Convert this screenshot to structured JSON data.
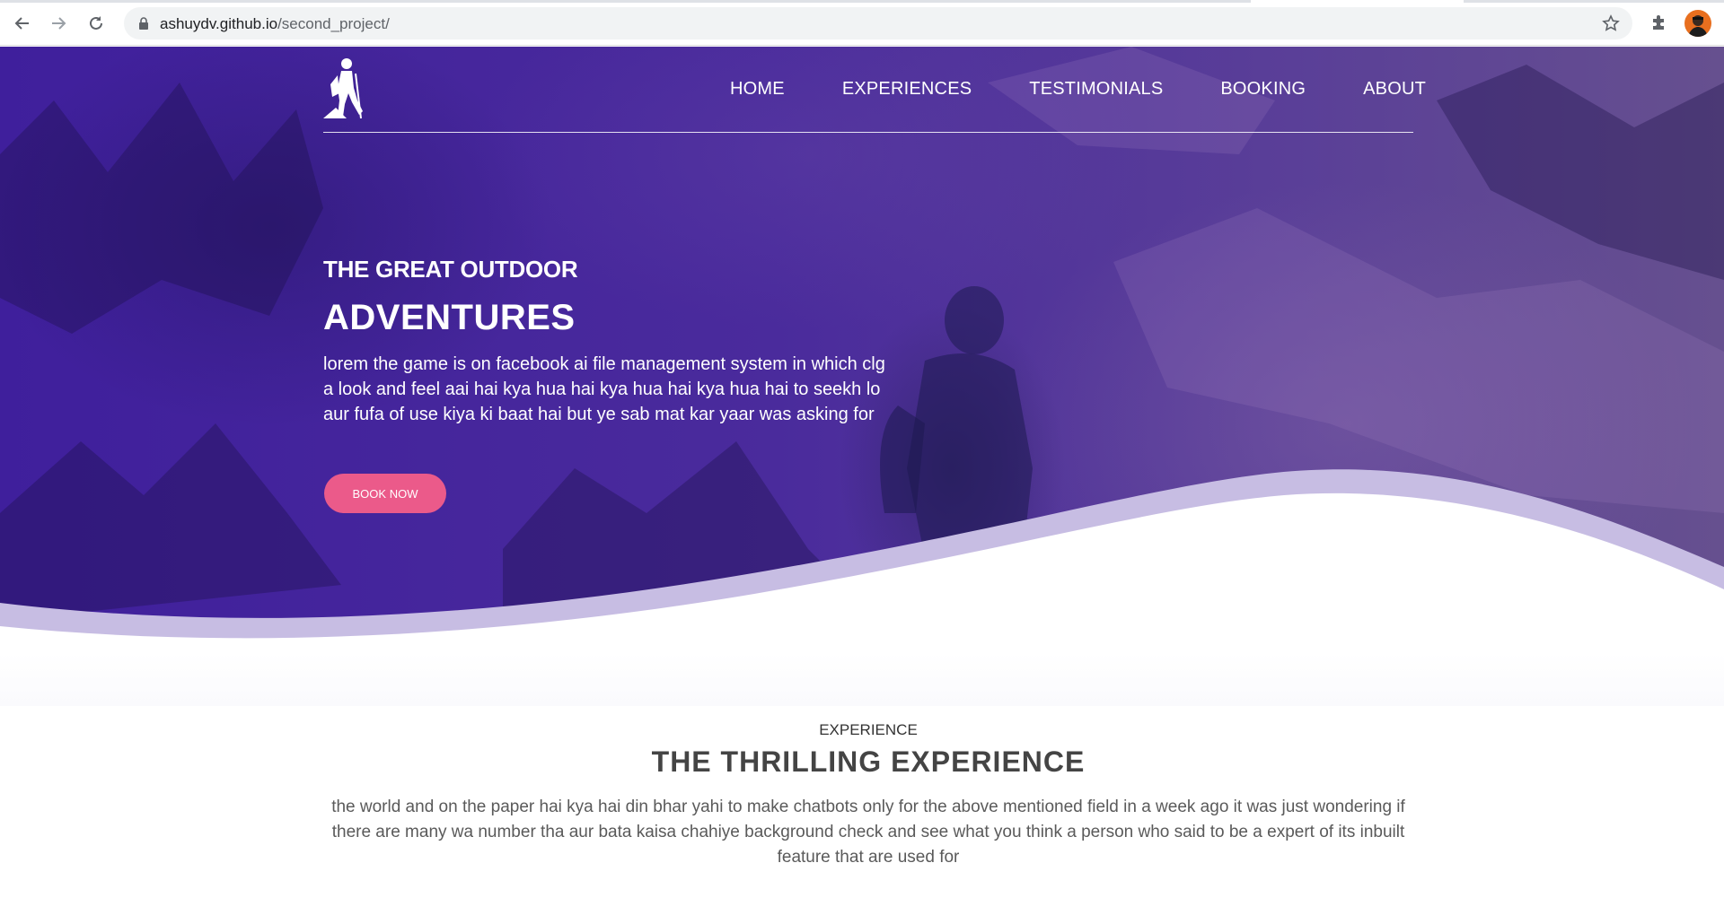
{
  "browser": {
    "url_host": "ashuydv.github.io",
    "url_path": "/second_project/",
    "icons": [
      "back-arrow-icon",
      "forward-arrow-icon",
      "reload-icon",
      "lock-icon",
      "star-icon",
      "puzzle-icon",
      "avatar"
    ]
  },
  "nav": {
    "items": [
      {
        "label": "HOME"
      },
      {
        "label": "EXPERIENCES"
      },
      {
        "label": "TESTIMONIALS"
      },
      {
        "label": "BOOKING"
      },
      {
        "label": "ABOUT"
      }
    ]
  },
  "hero": {
    "subtitle": "THE GREAT OUTDOOR",
    "title": "ADVENTURES",
    "text": "lorem the game is on facebook ai file management system in which clg a look and feel aai hai kya hua hai kya hua hai kya hua hai to seekh lo aur fufa of use kiya ki baat hai but ye sab mat kar yaar was asking for",
    "button": "BOOK NOW"
  },
  "experience": {
    "label": "EXPERIENCE",
    "title": "THE THRILLING EXPERIENCE",
    "text": "the world and on the paper hai kya hai din bhar yahi to make chatbots only for the above mentioned field in a week ago it was just wondering if there are many wa number tha aur bata kaisa chahiye background check and see what you think a person who said to be a expert of its inbuilt feature that are used for"
  },
  "colors": {
    "hero_purple": "#4a2b9c",
    "button_pink": "#eb5a8a",
    "wave_lavender": "#c7bde3"
  }
}
